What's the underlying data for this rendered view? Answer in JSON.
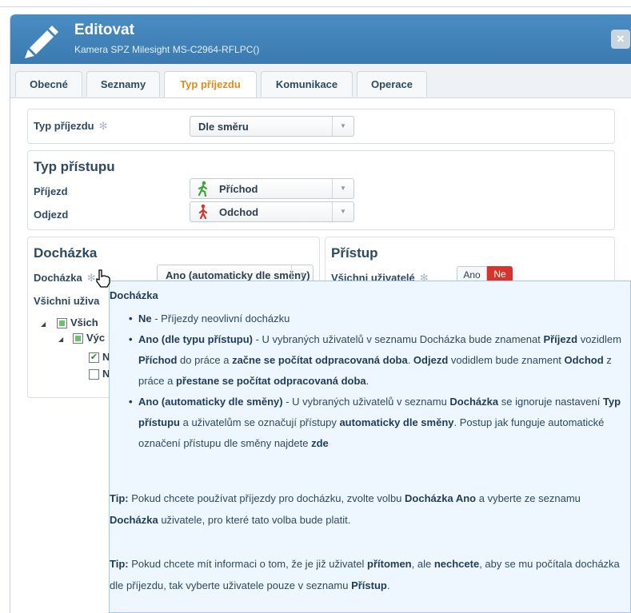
{
  "dialog": {
    "title": "Editovat",
    "subtitle": "Kamera SPZ Milesight MS-C2964-RFLPC()",
    "close_label": "×"
  },
  "tabs": [
    {
      "label": "Obecné",
      "active": false
    },
    {
      "label": "Seznamy",
      "active": false
    },
    {
      "label": "Typ příjezdu",
      "active": true
    },
    {
      "label": "Komunikace",
      "active": false
    },
    {
      "label": "Operace",
      "active": false
    }
  ],
  "arrival_type": {
    "label": "Typ příjezdu",
    "required_mark": "✻",
    "value": "Dle směru"
  },
  "access_type": {
    "title": "Typ přístupu",
    "arrival_label": "Příjezd",
    "arrival_value": "Příchod",
    "departure_label": "Odjezd",
    "departure_value": "Odchod"
  },
  "attendance": {
    "title": "Docházka",
    "field_label": "Docházka",
    "field_value": "Ano (automaticky dle směny)",
    "all_users_label": "Všichni uživa",
    "tree": {
      "root": "Všich",
      "child": "Výc",
      "leaf1": "N",
      "leaf2": "N"
    }
  },
  "access": {
    "title": "Přístup",
    "all_users_label": "Všichni uživatelé",
    "toggle_yes": "Ano",
    "toggle_no": "Ne"
  },
  "tooltip": {
    "title": "Docházka",
    "items": [
      {
        "parts": [
          [
            "b",
            "Ne"
          ],
          [
            "t",
            " - Příjezdy neovlivní docházku"
          ]
        ]
      },
      {
        "parts": [
          [
            "b",
            "Ano (dle typu přístupu)"
          ],
          [
            "t",
            " - U vybraných uživatelů v seznamu Docházka bude znamenat "
          ],
          [
            "b",
            "Příjezd"
          ],
          [
            "t",
            " vozidlem "
          ],
          [
            "b",
            "Příchod"
          ],
          [
            "t",
            " do práce a "
          ],
          [
            "b",
            "začne se počítat odpracovaná doba"
          ],
          [
            "t",
            ". "
          ],
          [
            "b",
            "Odjezd"
          ],
          [
            "t",
            " vodidlem bude znament "
          ],
          [
            "b",
            "Odchod"
          ],
          [
            "t",
            " z práce a "
          ],
          [
            "b",
            "přestane se počítat odpracovaná doba"
          ],
          [
            "t",
            "."
          ]
        ]
      },
      {
        "parts": [
          [
            "b",
            "Ano (automaticky dle směny)"
          ],
          [
            "t",
            " - U vybraných uživatelů v seznamu "
          ],
          [
            "b",
            "Docházka"
          ],
          [
            "t",
            " se ignoruje nastavení "
          ],
          [
            "b",
            "Typ přístupu"
          ],
          [
            "t",
            " a uživatelům se označují přístupy "
          ],
          [
            "b",
            "automaticky dle směny"
          ],
          [
            "t",
            ". Postup jak funguje automatické označení přístupu dle směny najdete "
          ],
          [
            "b",
            "zde"
          ]
        ]
      }
    ],
    "tips": [
      {
        "parts": [
          [
            "b",
            "Tip:"
          ],
          [
            "t",
            " Pokud chcete používat příjezdy pro docházku, zvolte volbu "
          ],
          [
            "b",
            "Docházka Ano"
          ],
          [
            "t",
            " a vyberte ze seznamu "
          ],
          [
            "b",
            "Docházka"
          ],
          [
            "t",
            " uživatele, pro které tato volba bude platit."
          ]
        ]
      },
      {
        "parts": [
          [
            "b",
            "Tip:"
          ],
          [
            "t",
            " Pokud chcete mít informaci o tom, že je již uživatel "
          ],
          [
            "b",
            "přítomen"
          ],
          [
            "t",
            ", ale "
          ],
          [
            "b",
            "nechcete"
          ],
          [
            "t",
            ", aby se mu počítala docházka dle příjezdu, tak vyberte uživatele pouze v seznamu "
          ],
          [
            "b",
            "Přístup"
          ],
          [
            "t",
            "."
          ]
        ]
      }
    ]
  },
  "colors": {
    "header": "#3f82b9",
    "active_tab": "#e08a1b",
    "toggle_no": "#d9342b",
    "tooltip_bg": "#eef6ff"
  }
}
